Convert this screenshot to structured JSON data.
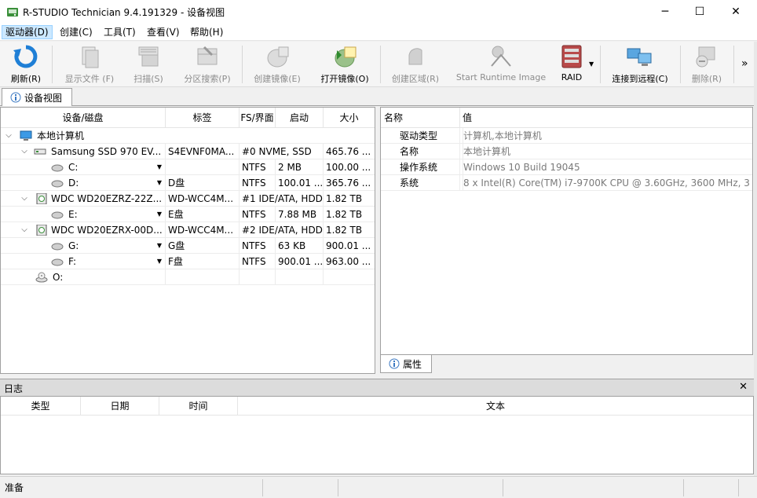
{
  "window": {
    "title": "R-STUDIO Technician 9.4.191329 - 设备视图",
    "minimize": "─",
    "maximize": "☐",
    "close": "✕"
  },
  "menu": [
    {
      "label": "驱动器(D)"
    },
    {
      "label": "创建(C)"
    },
    {
      "label": "工具(T)"
    },
    {
      "label": "查看(V)"
    },
    {
      "label": "帮助(H)"
    }
  ],
  "toolbar": {
    "refresh": "刷新(R)",
    "show_files": "显示文件 (F)",
    "scan": "扫描(S)",
    "partition_search": "分区搜索(P)",
    "create_image": "创建镜像(E)",
    "open_image": "打开镜像(O)",
    "create_region": "创建区域(R)",
    "start_runtime": "Start Runtime Image",
    "raid": "RAID",
    "connect_remote": "连接到远程(C)",
    "delete": "删除(R)",
    "more": "»"
  },
  "doc_tab": {
    "label": "设备视图"
  },
  "device_grid": {
    "headers": [
      "设备/磁盘",
      "标签",
      "FS/界面",
      "启动",
      "大小"
    ],
    "rows": [
      {
        "name": "本地计算机",
        "label": "",
        "fs": "",
        "start": "",
        "size": ""
      },
      {
        "name": "Samsung SSD 970 EV...",
        "label": "S4EVNF0MA...",
        "fs": "#0 NVME, SSD",
        "start": "",
        "size": "465.76 ..."
      },
      {
        "name": "C:",
        "label": "",
        "fs": "NTFS",
        "start": "2 MB",
        "size": "100.00 ..."
      },
      {
        "name": "D:",
        "label": "D盘",
        "fs": "NTFS",
        "start": "100.01 ...",
        "size": "365.76 ..."
      },
      {
        "name": "WDC WD20EZRZ-22Z...",
        "label": "WD-WCC4M...",
        "fs": "#1 IDE/ATA, HDD",
        "start": "",
        "size": "1.82 TB"
      },
      {
        "name": "E:",
        "label": "E盘",
        "fs": "NTFS",
        "start": "7.88 MB",
        "size": "1.82 TB"
      },
      {
        "name": "WDC WD20EZRX-00D...",
        "label": "WD-WCC4M...",
        "fs": "#2 IDE/ATA, HDD",
        "start": "",
        "size": "1.82 TB"
      },
      {
        "name": "G:",
        "label": "G盘",
        "fs": "NTFS",
        "start": "63 KB",
        "size": "900.01 ..."
      },
      {
        "name": "F:",
        "label": "F盘",
        "fs": "NTFS",
        "start": "900.01 ...",
        "size": "963.00 ..."
      },
      {
        "name": "O:",
        "label": "",
        "fs": "",
        "start": "",
        "size": ""
      }
    ]
  },
  "properties": {
    "headers": [
      "名称",
      "值"
    ],
    "rows": [
      {
        "name": "驱动类型",
        "value": "计算机,本地计算机"
      },
      {
        "name": "名称",
        "value": "本地计算机"
      },
      {
        "name": "操作系统",
        "value": "Windows 10 Build 19045"
      },
      {
        "name": "系统",
        "value": "8 x Intel(R) Core(TM) i7-9700K CPU @ 3.60GHz, 3600 MHz, 3..."
      }
    ],
    "tab": "属性"
  },
  "log": {
    "title": "日志",
    "close": "✕",
    "headers": [
      "类型",
      "日期",
      "时间",
      "文本"
    ]
  },
  "status": {
    "text": "准备"
  }
}
